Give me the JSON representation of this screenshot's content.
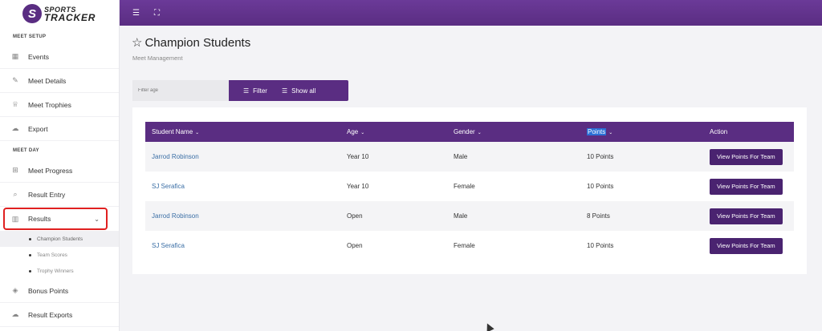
{
  "brand": {
    "line1": "SPORTS",
    "line2": "TRACKER",
    "mark": "S"
  },
  "sidebar": {
    "section_setup": "MEET SETUP",
    "section_day": "MEET DAY",
    "items": [
      {
        "label": "Events",
        "icon": "calendar-icon"
      },
      {
        "label": "Meet Details",
        "icon": "edit-icon"
      },
      {
        "label": "Meet Trophies",
        "icon": "trophy-icon"
      },
      {
        "label": "Export",
        "icon": "cloud-icon"
      },
      {
        "label": "Meet Progress",
        "icon": "grid-icon"
      },
      {
        "label": "Result Entry",
        "icon": "search-icon"
      },
      {
        "label": "Results",
        "icon": "bar-chart-icon"
      },
      {
        "label": "Bonus Points",
        "icon": "diamond-icon"
      },
      {
        "label": "Result Exports",
        "icon": "cloud-icon"
      }
    ],
    "sub_items": [
      "Champion Students",
      "Team Scores",
      "Trophy Winners"
    ]
  },
  "page": {
    "title": "Champion Students",
    "subtitle": "Meet Management"
  },
  "filter": {
    "placeholder": "Filter age",
    "filter_label": "Filter",
    "show_all_label": "Show all"
  },
  "table": {
    "headers": [
      "Student Name",
      "Age",
      "Gender",
      "Points",
      "Action"
    ],
    "rows": [
      {
        "name": "Jarrod Robinson",
        "age": "Year 10",
        "gender": "Male",
        "points": "10 Points",
        "action": "View Points For Team"
      },
      {
        "name": "SJ Serafica",
        "age": "Year 10",
        "gender": "Female",
        "points": "10 Points",
        "action": "View Points For Team"
      },
      {
        "name": "Jarrod Robinson",
        "age": "Open",
        "gender": "Male",
        "points": "8 Points",
        "action": "View Points For Team"
      },
      {
        "name": "SJ Serafica",
        "age": "Open",
        "gender": "Female",
        "points": "10 Points",
        "action": "View Points For Team"
      }
    ]
  },
  "colors": {
    "primary": "#5a2d82",
    "link": "#3a6ea5",
    "highlight": "#e02020"
  }
}
